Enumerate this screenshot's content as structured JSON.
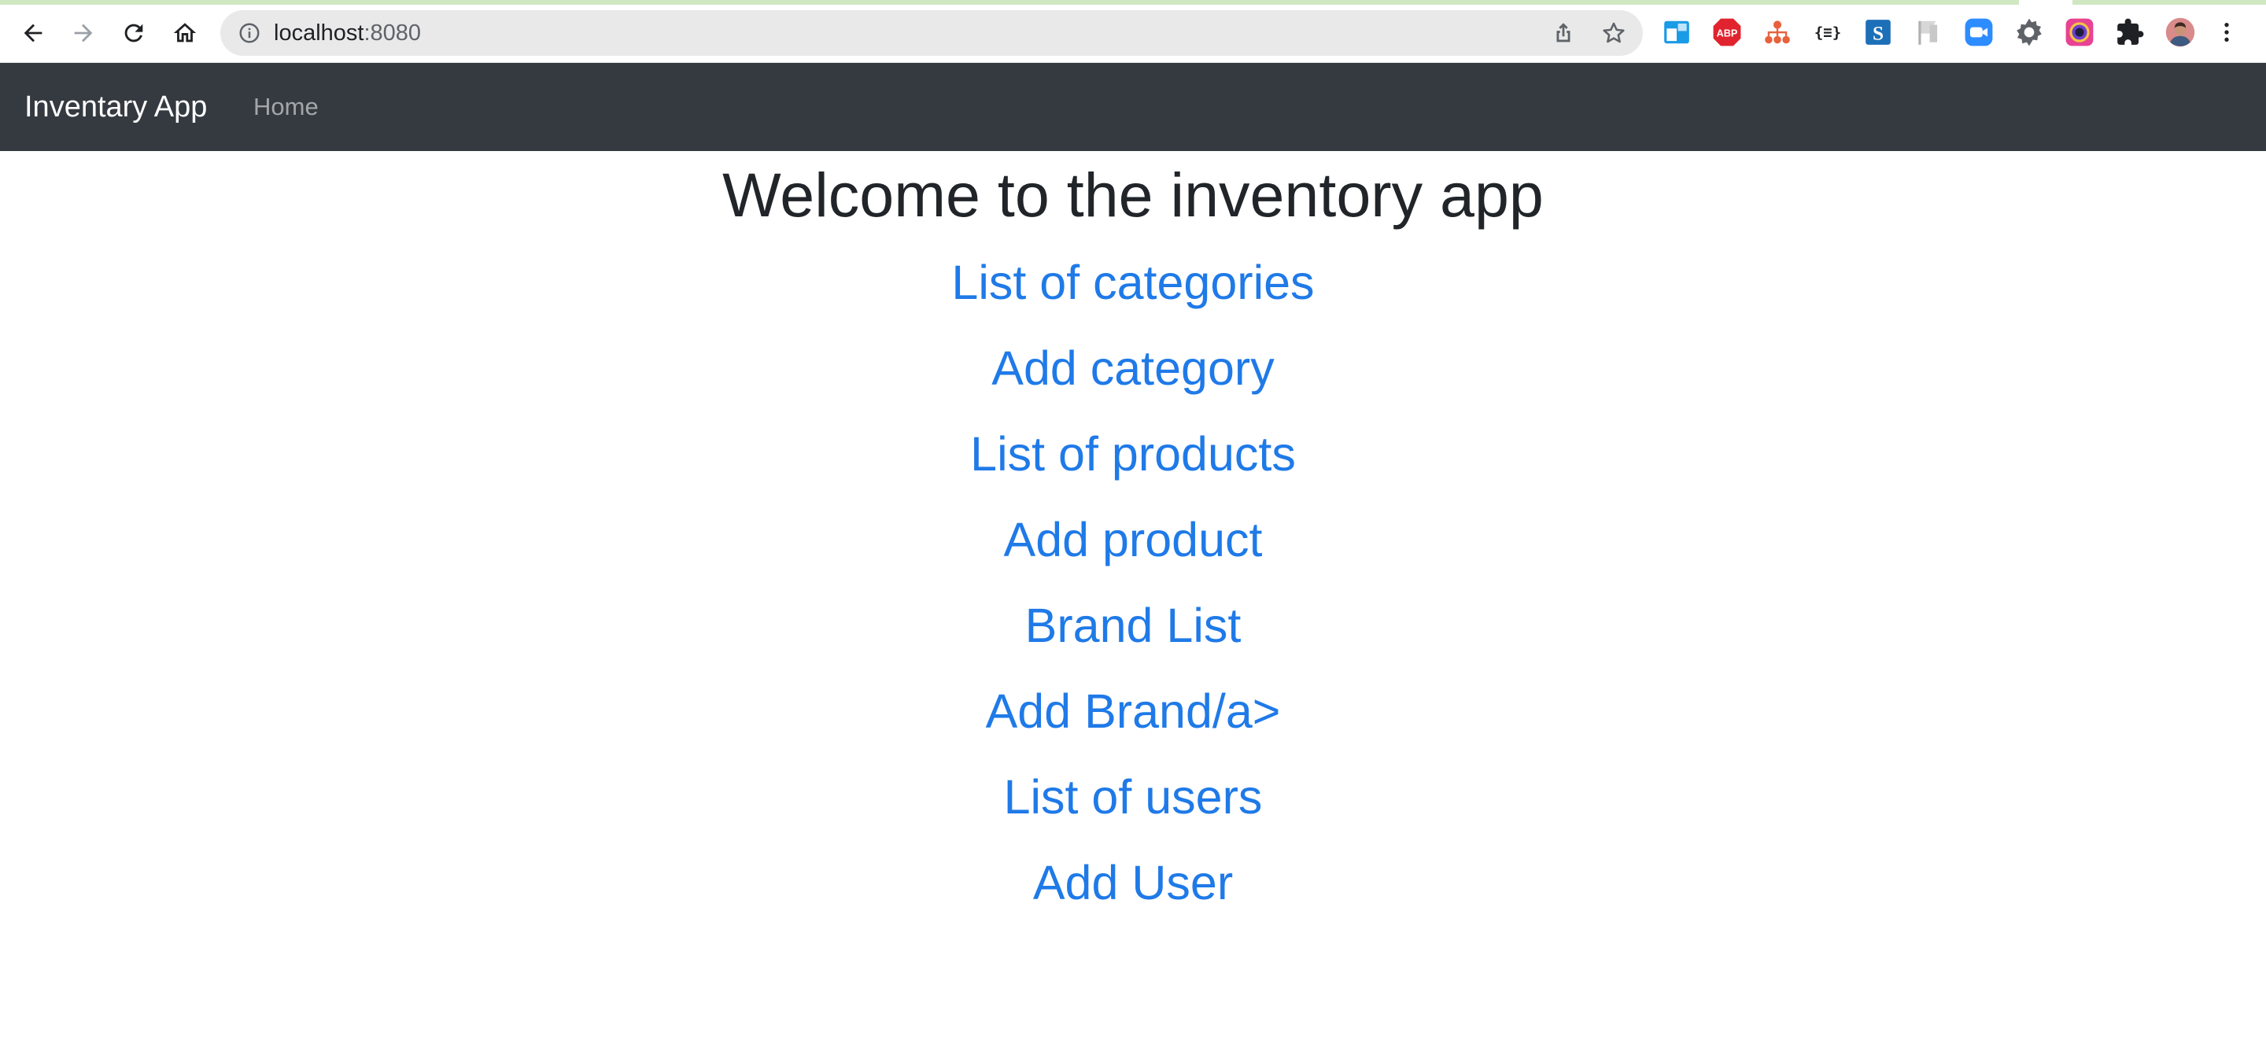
{
  "browser": {
    "url_host": "localhost",
    "url_port": ":8080",
    "icons": {
      "back": "arrow-left-icon",
      "forward": "arrow-right-icon",
      "reload": "reload-icon",
      "home": "home-icon",
      "site_info": "info-icon",
      "share": "share-icon",
      "bookmark": "star-icon",
      "menu": "kebab-menu-icon"
    },
    "extensions": [
      {
        "name": "window-ext-icon",
        "color": "#1a9be6"
      },
      {
        "name": "adblock-icon",
        "label": "ABP",
        "color": "#e0232e"
      },
      {
        "name": "sitemap-ext-icon",
        "color": "#e8603c"
      },
      {
        "name": "json-ext-icon",
        "label": "{≡}",
        "color": "#202124"
      },
      {
        "name": "s-ext-icon",
        "label": "S",
        "color": "#1d6fb8"
      },
      {
        "name": "flag-ext-icon",
        "color": "#b0b0b0"
      },
      {
        "name": "zoom-ext-icon",
        "color": "#2d8cff"
      },
      {
        "name": "gear-ext-icon",
        "color": "#5f6368"
      },
      {
        "name": "circle-ext-icon",
        "color": "#6b3fd1"
      },
      {
        "name": "puzzle-icon",
        "color": "#202124"
      },
      {
        "name": "avatar",
        "color": "#c76b6b"
      }
    ]
  },
  "navbar": {
    "brand": "Inventary App",
    "home": "Home",
    "colors": {
      "background": "#343a40",
      "brand": "#ffffff",
      "link": "rgba(255,255,255,0.55)"
    }
  },
  "main": {
    "title": "Welcome to the inventory app",
    "link_color": "#1f7ae8",
    "links": [
      {
        "label": "List of categories"
      },
      {
        "label": "Add category"
      },
      {
        "label": "List of products"
      },
      {
        "label": "Add product"
      },
      {
        "label": "Brand List"
      },
      {
        "label": "Add Brand/a>"
      },
      {
        "label": "List of users"
      },
      {
        "label": "Add User"
      }
    ]
  }
}
